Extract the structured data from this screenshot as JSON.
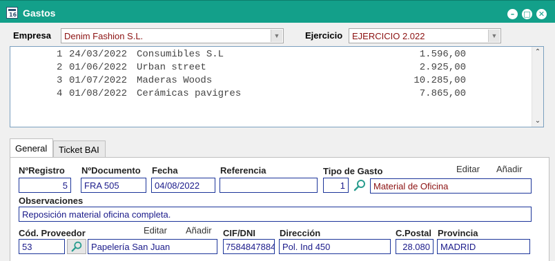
{
  "window": {
    "title": "Gastos",
    "icon": "calendar-icon"
  },
  "filters": {
    "empresa_label": "Empresa",
    "empresa_value": "Denim Fashion S.L.",
    "ejercicio_label": "Ejercicio",
    "ejercicio_value": "EJERCICIO 2.022"
  },
  "list": {
    "rows": [
      {
        "num": "1",
        "date": "24/03/2022",
        "name": "Consumibles S.L",
        "amount": "1.596,00"
      },
      {
        "num": "2",
        "date": "01/06/2022",
        "name": "Urban street",
        "amount": "2.925,00"
      },
      {
        "num": "3",
        "date": "01/07/2022",
        "name": "Maderas Woods",
        "amount": "10.285,00"
      },
      {
        "num": "4",
        "date": "01/08/2022",
        "name": "Cerámicas pavigres",
        "amount": "7.865,00"
      }
    ]
  },
  "tabs": [
    {
      "label": "General",
      "active": true
    },
    {
      "label": "Ticket BAI",
      "active": false
    }
  ],
  "form": {
    "nregistro_label": "NºRegistro",
    "nregistro_value": "5",
    "ndocumento_label": "NºDocumento",
    "ndocumento_value": "FRA 505",
    "fecha_label": "Fecha",
    "fecha_value": "04/08/2022",
    "referencia_label": "Referencia",
    "referencia_value": "",
    "tipo_gasto_label": "Tipo de Gasto",
    "tipo_gasto_code": "1",
    "tipo_gasto_name": "Material de Oficina",
    "tipo_editar": "Editar",
    "tipo_anadir": "Añadir",
    "observaciones_label": "Observaciones",
    "observaciones_value": "Reposición material oficina completa.",
    "cod_proveedor_label": "Cód. Proveedor",
    "cod_proveedor_value": "53",
    "proveedor_name": "Papelería San Juan",
    "proveedor_editar": "Editar",
    "proveedor_anadir": "Añadir",
    "cif_label": "CIF/DNI",
    "cif_value": "7584847884",
    "direccion_label": "Dirección",
    "direccion_value": "Pol. Ind 450",
    "cpostal_label": "C.Postal",
    "cpostal_value": "28.080",
    "provincia_label": "Provincia",
    "provincia_value": "MADRID"
  }
}
